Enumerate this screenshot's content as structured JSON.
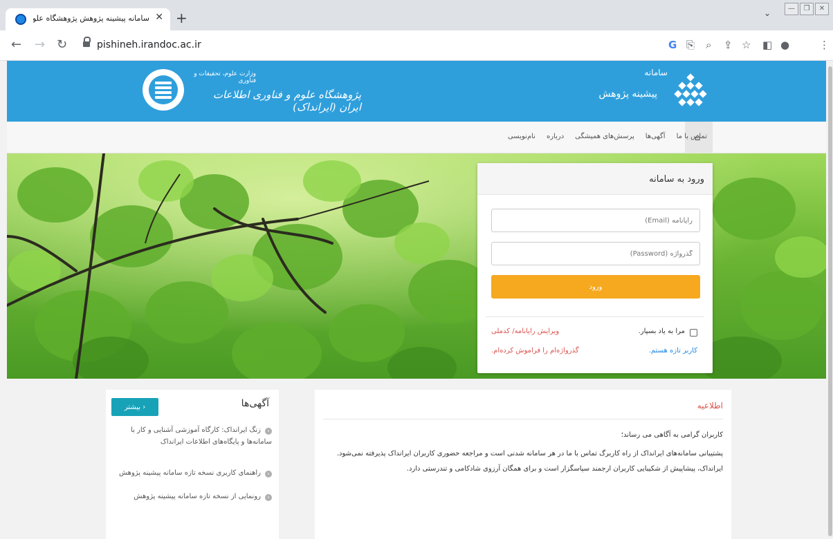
{
  "browser": {
    "tab_title": "سامانه پیشینه پژوهش پژوهشگاه علوم و فناو",
    "tab_close": "✕",
    "new_tab": "+",
    "url": "pishineh.irandoc.ac.ir"
  },
  "header": {
    "ministry": "وزارت علوم، تحقیقات و فناوری",
    "institute": "پژوهشگاه علوم و فناوری اطلاعات ایران (ایرانداک)",
    "system_label": "سامانه",
    "system_name": "پیشینه پژوهش"
  },
  "nav": {
    "items": [
      "نام‌نویسی",
      "درباره",
      "پرسش‌های همیشگی",
      "آگهی‌ها",
      "تماس با ما"
    ]
  },
  "login": {
    "title": "ورود به سامانه",
    "email_placeholder": "رایانامه (Email)",
    "password_placeholder": "گذرواژه (Password)",
    "submit": "ورود",
    "remember": "مرا به یاد بسپار.",
    "edit_link": "ویرایش رایانامه/ کدملی",
    "new_user": "کاربر تازه هستم.",
    "forgot": "گذرواژه‌ام را فراموش کرده‌ام."
  },
  "announcements": {
    "title": "آگهی‌ها",
    "more": "بیشتر",
    "items": [
      "زنگ ایرانداک: کارگاه آموزشی آشنایی و کار با سامانه‌ها و پایگاه‌های اطلاعات ایرانداک",
      "راهنمای کاربری نسخه تازه سامانه پیشینه پژوهش",
      "رونمایی از نسخه تازه سامانه پیشینه پژوهش"
    ]
  },
  "info": {
    "title": "اطلاعیه",
    "greeting": "کاربران گرامی به آگاهی می رساند؛",
    "body": "پشتیبانی سامانه‌های ایرانداک از راه کاربرگ تماس با ما در هر سامانه شدنی است و مراجعه حضوری کاربران ایرانداک پذیرفته نمی‌شود. ایرانداک، پیشاپیش از شکیبایی کاربران ارجمند سپاسگزار است و برای همگان آرزوی شادکامی و تندرستی دارد."
  },
  "colors": {
    "header_blue": "#2f9fdc",
    "login_button": "#f6a81f",
    "link_red": "#d9534f",
    "link_blue": "#1e88e5",
    "more_button": "#17a2b8"
  }
}
